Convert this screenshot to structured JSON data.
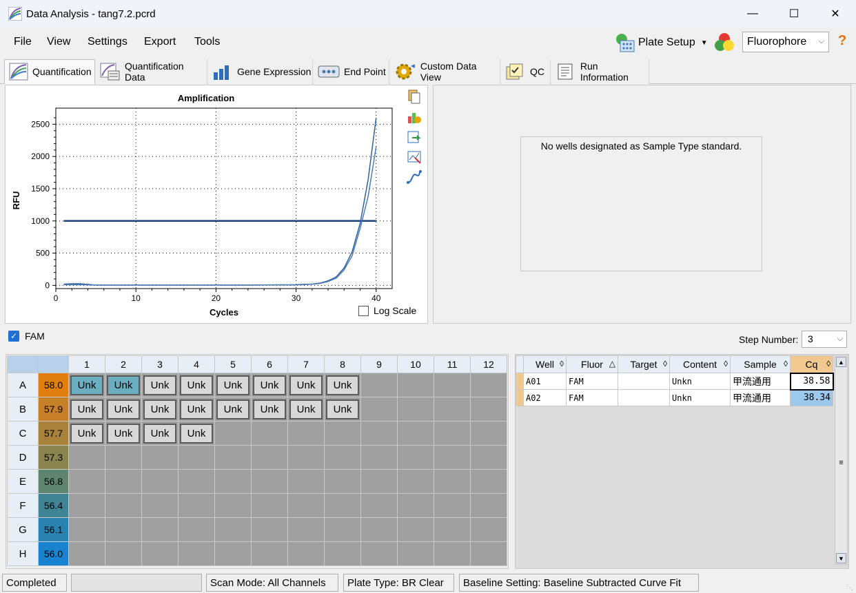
{
  "window": {
    "title": "Data Analysis - tang7.2.pcrd",
    "minimize": "—",
    "maximize": "☐",
    "close": "✕"
  },
  "menu": {
    "items": [
      "File",
      "View",
      "Settings",
      "Export",
      "Tools"
    ],
    "plate_setup": "Plate Setup",
    "fluor_select": "Fluorophore",
    "help": "?"
  },
  "tabs": [
    "Quantification",
    "Quantification Data",
    "Gene Expression",
    "End Point",
    "Custom Data View",
    "QC",
    "Run Information"
  ],
  "chart_data": {
    "type": "line",
    "title": "Amplification",
    "xlabel": "Cycles",
    "ylabel": "RFU",
    "xlim": [
      0,
      42
    ],
    "ylim": [
      -50,
      2750
    ],
    "xticks": [
      0,
      10,
      20,
      30,
      40
    ],
    "yticks": [
      0,
      500,
      1000,
      1500,
      2000,
      2500
    ],
    "grid": true,
    "threshold": 1000,
    "threshold_range": [
      1,
      40
    ],
    "series": [
      {
        "values_x": [
          1,
          2,
          3,
          4,
          5,
          6,
          8,
          10,
          15,
          20,
          25,
          30,
          31,
          32,
          33,
          34,
          35,
          36,
          37,
          38,
          39,
          40
        ],
        "values_y": [
          20,
          25,
          25,
          15,
          5,
          5,
          5,
          5,
          5,
          5,
          5,
          10,
          15,
          20,
          35,
          70,
          130,
          270,
          520,
          960,
          1640,
          2600
        ]
      },
      {
        "values_x": [
          1,
          2,
          3,
          4,
          5,
          6,
          8,
          10,
          15,
          20,
          25,
          30,
          31,
          32,
          33,
          34,
          35,
          36,
          37,
          38,
          39,
          40
        ],
        "values_y": [
          10,
          10,
          12,
          8,
          5,
          5,
          5,
          5,
          5,
          5,
          5,
          8,
          12,
          18,
          30,
          60,
          110,
          240,
          460,
          880,
          1380,
          2150
        ]
      }
    ]
  },
  "chart": {
    "log_scale_label": "Log Scale",
    "log_scale_checked": false
  },
  "standard": {
    "message": "No wells designated as Sample Type standard."
  },
  "fam": {
    "label": "FAM",
    "checked": true
  },
  "step": {
    "label": "Step Number:",
    "value": "3"
  },
  "plate": {
    "columns": [
      "1",
      "2",
      "3",
      "4",
      "5",
      "6",
      "7",
      "8",
      "9",
      "10",
      "11",
      "12"
    ],
    "rows": [
      {
        "label": "A",
        "temp": "58.0",
        "color": "#e07f10",
        "wells": [
          "Unk",
          "Unk",
          "Unk",
          "Unk",
          "Unk",
          "Unk",
          "Unk",
          "Unk",
          "",
          "",
          "",
          ""
        ],
        "selected": [
          0,
          1
        ]
      },
      {
        "label": "B",
        "temp": "57.9",
        "color": "#c7802a",
        "wells": [
          "Unk",
          "Unk",
          "Unk",
          "Unk",
          "Unk",
          "Unk",
          "Unk",
          "Unk",
          "",
          "",
          "",
          ""
        ],
        "selected": []
      },
      {
        "label": "C",
        "temp": "57.7",
        "color": "#a8813a",
        "wells": [
          "Unk",
          "Unk",
          "Unk",
          "Unk",
          "",
          "",
          "",
          "",
          "",
          "",
          "",
          ""
        ],
        "selected": []
      },
      {
        "label": "D",
        "temp": "57.3",
        "color": "#8a8450",
        "wells": [
          "",
          "",
          "",
          "",
          "",
          "",
          "",
          "",
          "",
          "",
          "",
          ""
        ],
        "selected": []
      },
      {
        "label": "E",
        "temp": "56.8",
        "color": "#5e8470",
        "wells": [
          "",
          "",
          "",
          "",
          "",
          "",
          "",
          "",
          "",
          "",
          "",
          ""
        ],
        "selected": []
      },
      {
        "label": "F",
        "temp": "56.4",
        "color": "#3f8394",
        "wells": [
          "",
          "",
          "",
          "",
          "",
          "",
          "",
          "",
          "",
          "",
          "",
          ""
        ],
        "selected": []
      },
      {
        "label": "G",
        "temp": "56.1",
        "color": "#2a82b0",
        "wells": [
          "",
          "",
          "",
          "",
          "",
          "",
          "",
          "",
          "",
          "",
          "",
          ""
        ],
        "selected": []
      },
      {
        "label": "H",
        "temp": "56.0",
        "color": "#1a83d0",
        "wells": [
          "",
          "",
          "",
          "",
          "",
          "",
          "",
          "",
          "",
          "",
          "",
          ""
        ],
        "selected": []
      }
    ]
  },
  "results": {
    "headers": [
      "Well",
      "Fluor",
      "Target",
      "Content",
      "Sample",
      "Cq"
    ],
    "sort_icons": [
      "◊",
      "△",
      "◊",
      "◊",
      "◊",
      "◊"
    ],
    "rows": [
      {
        "well": "A01",
        "fluor": "FAM",
        "target": "",
        "content": "Unkn",
        "sample": "甲流通用",
        "cq": "38.58"
      },
      {
        "well": "A02",
        "fluor": "FAM",
        "target": "",
        "content": "Unkn",
        "sample": "甲流通用",
        "cq": "38.34"
      }
    ]
  },
  "status": {
    "state": "Completed",
    "scan_mode": "Scan Mode: All Channels",
    "plate_type": "Plate Type: BR Clear",
    "baseline": "Baseline Setting: Baseline Subtracted Curve Fit"
  }
}
